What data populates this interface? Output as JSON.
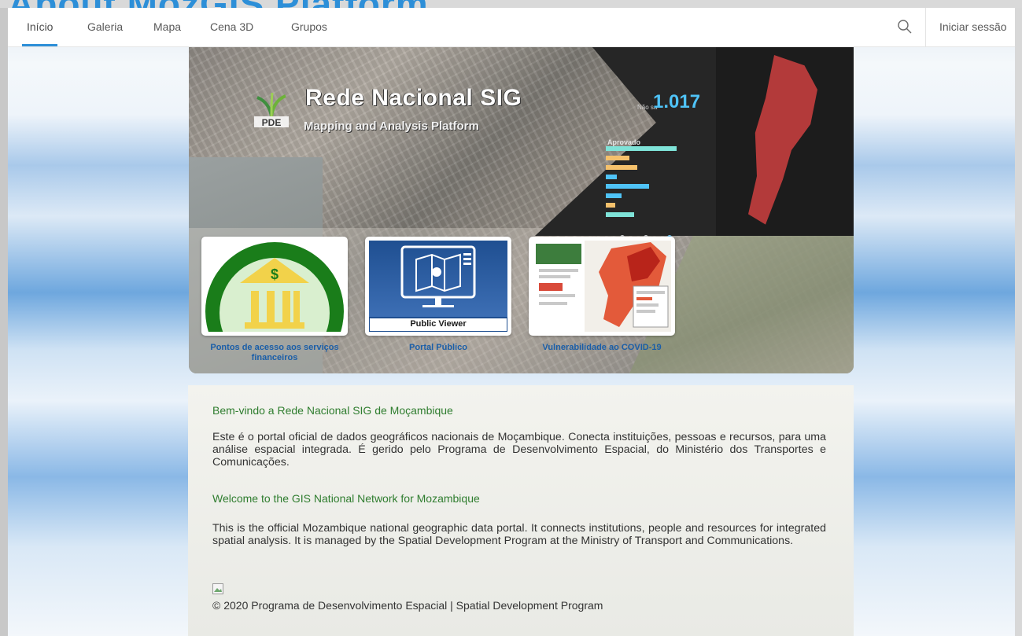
{
  "page": {
    "title": "About MozGIS Platform"
  },
  "nav": {
    "items": [
      {
        "label": "Início",
        "active": true
      },
      {
        "label": "Galeria"
      },
      {
        "label": "Mapa"
      },
      {
        "label": "Cena 3D"
      },
      {
        "label": "Grupos"
      }
    ],
    "search_icon": "search-icon",
    "signin_label": "Iniciar sessão",
    "accent_color": "#2d8fd8"
  },
  "hero": {
    "title": "Rede Nacional SIG",
    "subtitle": "Mapping and Analysis Platform",
    "logo_text": "PDE",
    "counter": "1.017",
    "counter_prefix": "Não sa",
    "chart_heading": "Aprovado",
    "slide_count": 3,
    "active_slide": 2
  },
  "cards": [
    {
      "label": "Pontos de acesso aos serviços financeiros",
      "icon": "bank-icon"
    },
    {
      "label": "Portal Público",
      "image_caption": "Public Viewer",
      "icon": "map-monitor-icon"
    },
    {
      "label": "Vulnerabilidade ao COVID-19",
      "icon": "covid-map-icon"
    }
  ],
  "content": {
    "pt_heading": "Bem-vindo a Rede Nacional SIG de Moçambique",
    "pt_body": "Este é o portal oficial de dados geográficos nacionais de Moçambique. Conecta instituições, pessoas e recursos, para uma análise espacial integrada. É gerido pelo Programa de Desenvolvimento Espacial, do Ministério dos Transportes e Comunicações.",
    "en_heading": "Welcome to the GIS National Network for Mozambique",
    "en_body": "This is the official Mozambique national geographic data portal. It connects institutions, people and resources for integrated spatial analysis. It is managed by the Spatial Development Program at the Ministry of Transport and Communications.",
    "copyright": "© 2020  Programa de Desenvolvimento Espacial | Spatial Development Program",
    "heading_color": "#2f7d2f",
    "link_color": "#1a5ea8"
  }
}
